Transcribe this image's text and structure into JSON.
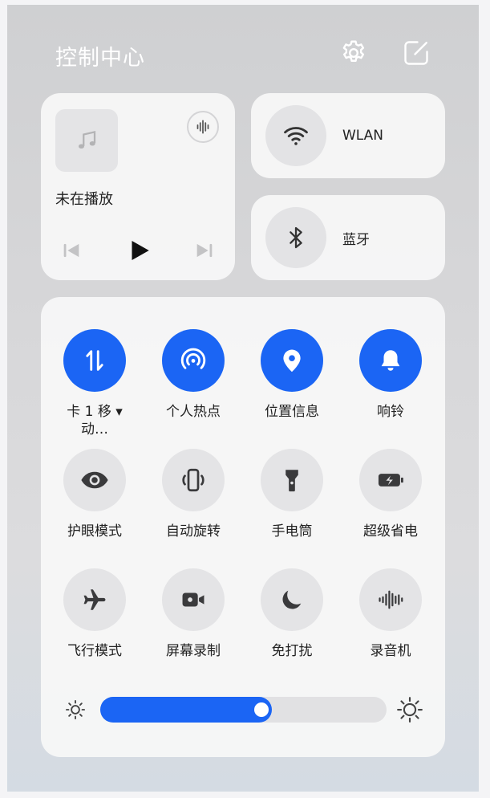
{
  "header": {
    "title": "控制中心"
  },
  "icons": {
    "settings": "gear-icon",
    "edit": "edit-icon"
  },
  "media": {
    "status": "未在播放"
  },
  "connectivity": {
    "wlan": "WLAN",
    "bluetooth": "蓝牙"
  },
  "toggles": [
    {
      "label": "卡 1 移 ▾ 动…",
      "icon": "mobile-data-icon",
      "active": true
    },
    {
      "label": "个人热点",
      "icon": "hotspot-icon",
      "active": true
    },
    {
      "label": "位置信息",
      "icon": "location-pin-icon",
      "active": true
    },
    {
      "label": "响铃",
      "icon": "bell-icon",
      "active": true
    },
    {
      "label": "护眼模式",
      "icon": "eye-icon",
      "active": false
    },
    {
      "label": "自动旋转",
      "icon": "auto-rotate-icon",
      "active": false
    },
    {
      "label": "手电筒",
      "icon": "flashlight-icon",
      "active": false
    },
    {
      "label": "超级省电",
      "icon": "battery-saver-icon",
      "active": false
    },
    {
      "label": "飞行模式",
      "icon": "airplane-icon",
      "active": false
    },
    {
      "label": "屏幕录制",
      "icon": "screen-record-icon",
      "active": false
    },
    {
      "label": "免打扰",
      "icon": "moon-icon",
      "active": false
    },
    {
      "label": "录音机",
      "icon": "sound-wave-icon",
      "active": false
    }
  ],
  "brightness": {
    "level": 0.6
  },
  "colors": {
    "accent": "#1b65f4",
    "inactive": "#e4e4e6"
  }
}
